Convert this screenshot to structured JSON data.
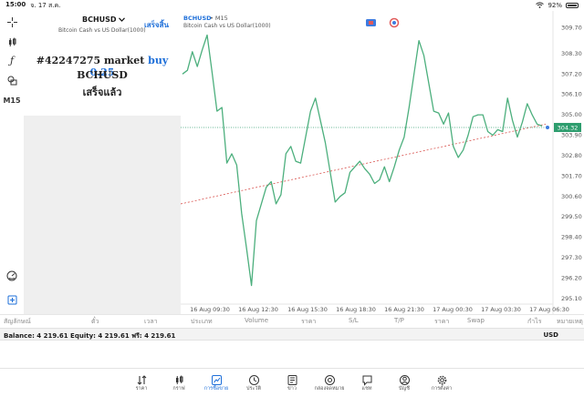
{
  "status_bar": {
    "time": "15:00",
    "date": "จ. 17 ส.ค.",
    "battery": "92%"
  },
  "toolbar": {
    "timeframe": "M15"
  },
  "symbol_panel": {
    "symbol": "BCHUSD",
    "description": "Bitcoin Cash vs US Dollar(1000)",
    "done_label": "เสร็จสิ้น",
    "order_prefix": "#42247275 market",
    "order_side": "buy 0.25",
    "order_symbol": "BCHUSD",
    "order_status": "เสร็จแล้ว"
  },
  "chart_header": {
    "symbol": "BCHUSD",
    "timeframe": "• M15",
    "description": "Bitcoin Cash vs US Dollar(1000)"
  },
  "chart_data": {
    "type": "line",
    "title": "",
    "x": [
      "16 Aug 09:30",
      "16 Aug 12:30",
      "16 Aug 15:30",
      "16 Aug 18:30",
      "16 Aug 21:30",
      "17 Aug 00:30",
      "17 Aug 03:30",
      "17 Aug 06:30"
    ],
    "y_ticks": [
      "309.70",
      "308.30",
      "307.20",
      "306.10",
      "305.00",
      "303.90",
      "302.80",
      "301.70",
      "300.60",
      "299.50",
      "298.40",
      "297.30",
      "296.20",
      "295.10"
    ],
    "ylim": [
      294.8,
      310.6
    ],
    "series": [
      {
        "values": [
          307.2,
          307.4,
          308.4,
          307.6,
          308.5,
          309.3,
          307.3,
          305.2,
          305.4,
          302.4,
          302.9,
          302.3,
          299.7,
          297.8,
          295.8,
          299.3,
          300.2,
          301.1,
          301.4,
          300.2,
          300.7,
          302.9,
          303.3,
          302.5,
          302.4,
          303.8,
          305.2,
          305.9,
          304.7,
          303.5,
          301.9,
          300.3,
          300.6,
          300.8,
          301.9,
          302.2,
          302.5,
          302.1,
          301.8,
          301.3,
          301.5,
          302.2,
          301.4,
          302.2,
          303.1,
          303.8,
          305.4,
          307.2,
          309.0,
          308.2,
          306.7,
          305.2,
          305.1,
          304.5,
          305.1,
          303.3,
          302.7,
          303.1,
          303.9,
          304.9,
          305.0,
          305.0,
          304.1,
          303.9,
          304.2,
          304.1,
          305.9,
          304.7,
          303.8,
          304.6,
          305.6,
          305.0,
          304.5,
          304.4
        ]
      }
    ],
    "current_price": "304.32",
    "trend_line": {
      "start": 300.2,
      "end": 304.5
    },
    "price_line": 304.32
  },
  "columns": [
    "สัญลักษณ์",
    "ตั๋ว",
    "เวลา",
    "ประเภท",
    "Volume",
    "ราคา",
    "S/L",
    "T/P",
    "ราคา",
    "Swap",
    "กำไร",
    "หมายเหตุ"
  ],
  "balance": {
    "text": "Balance: 4 219.61 Equity: 4 219.61 ฟรี: 4 219.61",
    "currency": "USD"
  },
  "nav": [
    {
      "label": "ราคา",
      "icon": "sort-arrows-icon"
    },
    {
      "label": "กราฟ",
      "icon": "candlestick-icon"
    },
    {
      "label": "การซื้อขาย",
      "icon": "trade-chart-icon"
    },
    {
      "label": "ประวัติ",
      "icon": "history-icon"
    },
    {
      "label": "ข่าว",
      "icon": "news-icon"
    },
    {
      "label": "กล่องจดหมาย",
      "icon": "mailbox-icon"
    },
    {
      "label": "แชท",
      "icon": "chat-icon"
    },
    {
      "label": "บัญชี",
      "icon": "account-icon"
    },
    {
      "label": "การตั้งค่า",
      "icon": "settings-gear-icon"
    }
  ],
  "colors": {
    "accent": "#1e6fd9",
    "line": "#4caf7d",
    "trend": "#d9534f",
    "price_label": "#2e9d6e"
  }
}
